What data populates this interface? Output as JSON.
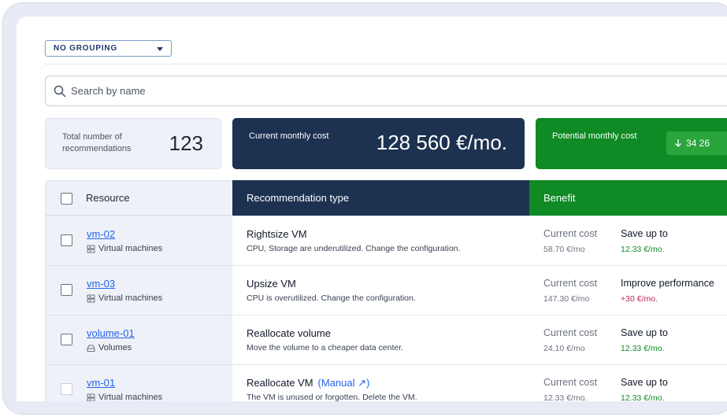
{
  "grouping": {
    "value": "NO GROUPING"
  },
  "search": {
    "placeholder": "Search by name"
  },
  "cards": {
    "total_label": "Total number of recommendations",
    "total_value": "123",
    "current_label": "Current monthly cost",
    "current_value": "128 560 €/mo.",
    "potential_label": "Potential monthly cost",
    "potential_value": "34 26"
  },
  "table": {
    "headers": {
      "resource": "Resource",
      "recommendation": "Recommendation type",
      "benefit": "Benefit"
    },
    "rows": [
      {
        "name": "vm-02",
        "category": "Virtual machines",
        "category_icon": "server-icon",
        "title": "Rightsize VM",
        "manual": "",
        "description": "CPU, Storage are underutilized. Change the configuration.",
        "cost_label": "Current cost",
        "cost_value": "58.70 €/mo",
        "benefit_label": "Save up to",
        "benefit_value": "12.33 €/mo.",
        "benefit_kind": "green",
        "disabled": false
      },
      {
        "name": "vm-03",
        "category": "Virtual machines",
        "category_icon": "server-icon",
        "title": "Upsize VM",
        "manual": "",
        "description": "CPU is overutilized. Change the configuration.",
        "cost_label": "Current cost",
        "cost_value": "147.30 €/mo",
        "benefit_label": "Improve performance",
        "benefit_value": "+30 €/mo.",
        "benefit_kind": "red",
        "disabled": false
      },
      {
        "name": "volume-01",
        "category": "Volumes",
        "category_icon": "volume-icon",
        "title": "Reallocate volume",
        "manual": "",
        "description": "Move the volume to a cheaper data center.",
        "cost_label": "Current cost",
        "cost_value": "24.10 €/mo",
        "benefit_label": "Save up to",
        "benefit_value": "12.33 €/mo.",
        "benefit_kind": "green",
        "disabled": false
      },
      {
        "name": "vm-01",
        "category": "Virtual machines",
        "category_icon": "server-icon",
        "title": "Reallocate VM",
        "manual": "(Manual ↗)",
        "description": "The VM is unused or forgotten. Delete the VM.",
        "cost_label": "Current cost",
        "cost_value": "12.33 €/mo.",
        "benefit_label": "Save up to",
        "benefit_value": "12.33 €/mo.",
        "benefit_kind": "green",
        "disabled": true
      }
    ]
  },
  "colors": {
    "navy": "#1d3251",
    "green": "#0f8a24",
    "link": "#2563eb",
    "negative": "#c0265e"
  }
}
